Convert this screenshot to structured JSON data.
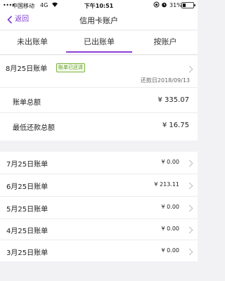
{
  "status_bar": {
    "signal": "••••",
    "carrier": "中国移动",
    "network": "4G",
    "time": "下午10:51",
    "battery": "31%"
  },
  "nav": {
    "back_label": "返回",
    "title": "信用卡账户"
  },
  "tabs": [
    {
      "label": "未出账单",
      "active": false
    },
    {
      "label": "已出账单",
      "active": true
    },
    {
      "label": "按账户",
      "active": false
    }
  ],
  "current_bill": {
    "date": "8月25日账单",
    "badge": "账单已还清",
    "due_date": "还款日2018/09/13",
    "total_label": "账单总额",
    "total_value": "¥ 335.07",
    "min_label": "最低还款总额",
    "min_value": "¥ 16.75"
  },
  "past_bills": [
    {
      "date": "7月25日账单",
      "amount": "¥ 0.00"
    },
    {
      "date": "6月25日账单",
      "amount": "¥ 213.11"
    },
    {
      "date": "5月25日账单",
      "amount": "¥ 0.00"
    },
    {
      "date": "4月25日账单",
      "amount": "¥ 0.00"
    },
    {
      "date": "3月25日账单",
      "amount": "¥ 0.00"
    }
  ],
  "colors": {
    "accent": "#8a3fd6",
    "badge_green": "#5f9e2a"
  }
}
